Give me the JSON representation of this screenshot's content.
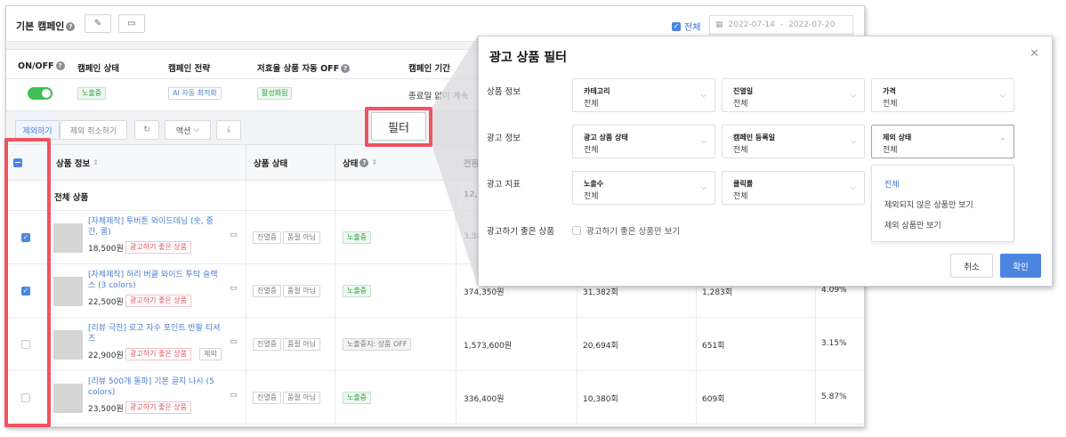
{
  "campaign_header": {
    "title": "기본 캠페인",
    "all_label": "전체",
    "date_start": "2022-07-14",
    "date_sep": "-",
    "date_end": "2022-07-20"
  },
  "campaign_table": {
    "headers": [
      "ON/OFF",
      "캠페인 상태",
      "캠페인 전략",
      "저효율 상품 자동 OFF",
      "캠페인 기간"
    ],
    "row": {
      "status": "노출중",
      "strategy": "AI 자동 최적화",
      "auto_off": "활성화됨",
      "period": "종료일 없이 계속"
    }
  },
  "toolbar": {
    "exclude": "제외하기",
    "unexclude": "제외 취소하기",
    "action": "액션",
    "filter": "필터"
  },
  "product_table": {
    "headers": [
      "상품 정보",
      "상품 상태",
      "상태",
      "전환"
    ],
    "all_products_label": "전체 상품",
    "all_products_value": "12,2",
    "rows": [
      {
        "name": "[자체제작] 투버튼 와이드데님 (숏, 중간, 롱)",
        "price": "18,500원",
        "badge": "광고하기 좋은 상품",
        "extra": "",
        "state1": "진열중",
        "state2": "품절 아님",
        "status": "노출중",
        "m1": "3,38",
        "m2": "",
        "m3": "",
        "m4": "",
        "checked": true
      },
      {
        "name": "[자체제작] 허리 버클 와이드 투턱 슬랙스 (3 colors)",
        "price": "22,500원",
        "badge": "광고하기 좋은 상품",
        "extra": "",
        "state1": "진열중",
        "state2": "품절 아님",
        "status": "노출중",
        "m1": "374,350원",
        "m2": "31,382회",
        "m3": "1,283회",
        "m4": "4.09%",
        "checked": true
      },
      {
        "name": "[리뷰 극찬] 로고 자수 포인트 반팔 티셔츠",
        "price": "22,900원",
        "badge": "광고하기 좋은 상품",
        "extra": "제외",
        "state1": "진열중",
        "state2": "품절 아님",
        "status": "노출중지: 상품 OFF",
        "m1": "1,573,600원",
        "m2": "20,694회",
        "m3": "651회",
        "m4": "3.15%",
        "checked": false
      },
      {
        "name": "[리뷰 500개 돌파] 기본 골지 나시 (5 colors)",
        "price": "23,500원",
        "badge": "광고하기 좋은 상품",
        "extra": "",
        "state1": "진열중",
        "state2": "품절 아님",
        "status": "노출중",
        "m1": "336,400원",
        "m2": "10,380회",
        "m3": "609회",
        "m4": "5.87%",
        "checked": false
      }
    ]
  },
  "modal": {
    "title": "광고 상품 필터",
    "sections": {
      "product_info": "상품 정보",
      "ad_info": "광고 정보",
      "ad_metric": "광고 지표",
      "good_product": "광고하기 좋은 상품"
    },
    "dropdowns": {
      "category": {
        "label": "카테고리",
        "value": "전체"
      },
      "display": {
        "label": "진열일",
        "value": "전체"
      },
      "price": {
        "label": "가격",
        "value": "전체"
      },
      "ad_status": {
        "label": "광고 상품 상태",
        "value": "전체"
      },
      "reg_date": {
        "label": "캠페인 등록일",
        "value": "전체"
      },
      "excl": {
        "label": "제외 상태",
        "value": "전체"
      },
      "impressions": {
        "label": "노출수",
        "value": "전체"
      },
      "ctr": {
        "label": "클릭률",
        "value": "전체"
      }
    },
    "excl_options": [
      "전체",
      "제외되지 않은 상품만 보기",
      "제외 상품만 보기"
    ],
    "good_checkbox_label": "광고하기 좋은 상품만 보기",
    "cancel": "취소",
    "ok": "확인"
  },
  "colors": {
    "highlight": "#f05360",
    "accent": "#4a86e0",
    "on_green": "#3fbf57"
  }
}
